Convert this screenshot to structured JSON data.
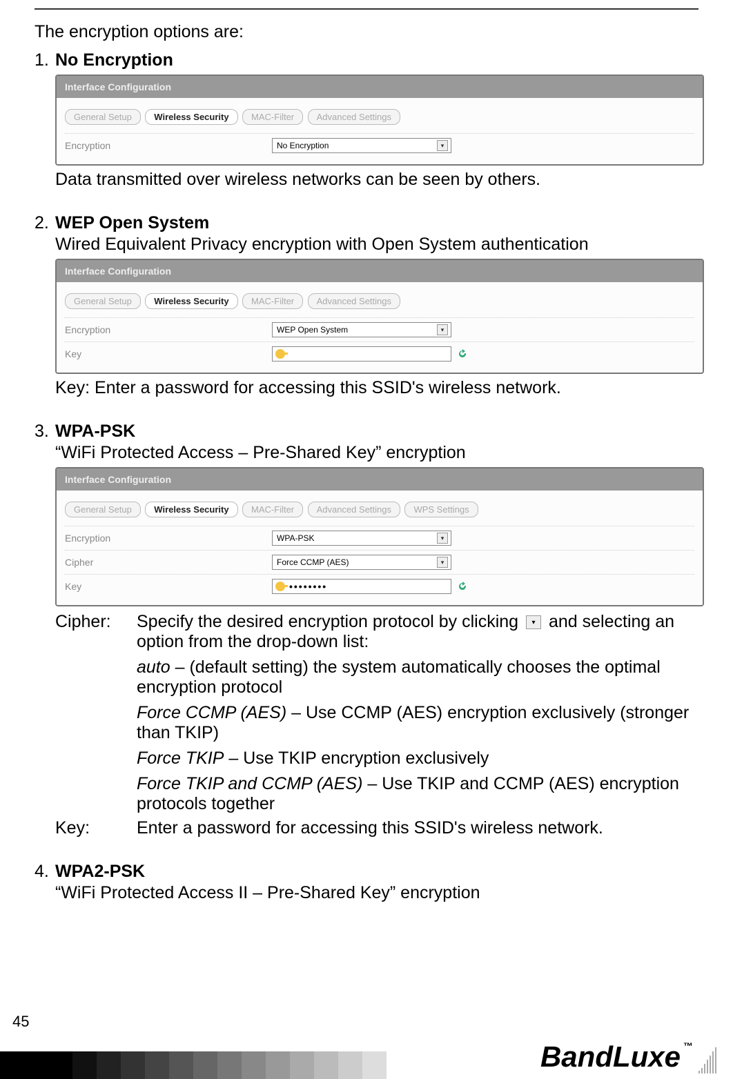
{
  "intro": "The encryption options are:",
  "items": [
    {
      "num": "1.",
      "title": "No Encryption",
      "panel": {
        "header": "Interface Configuration",
        "tabs": [
          "General Setup",
          "Wireless Security",
          "MAC-Filter",
          "Advanced Settings"
        ],
        "active_tab": 1,
        "rows": [
          {
            "label": "Encryption",
            "type": "select",
            "value": "No Encryption"
          }
        ]
      },
      "after": "Data transmitted over wireless networks can be seen by others."
    },
    {
      "num": "2.",
      "title": "WEP Open System",
      "subtitle": "Wired Equivalent Privacy encryption with Open System authentication",
      "panel": {
        "header": "Interface Configuration",
        "tabs": [
          "General Setup",
          "Wireless Security",
          "MAC-Filter",
          "Advanced Settings"
        ],
        "active_tab": 1,
        "rows": [
          {
            "label": "Encryption",
            "type": "select",
            "value": "WEP Open System"
          },
          {
            "label": "Key",
            "type": "key",
            "value": ""
          }
        ]
      },
      "after_key": "Key:    Enter a password for accessing this SSID's wireless network."
    },
    {
      "num": "3.",
      "title": "WPA-PSK",
      "subtitle": "“WiFi Protected Access – Pre-Shared Key” encryption",
      "panel": {
        "header": "Interface Configuration",
        "tabs": [
          "General Setup",
          "Wireless Security",
          "MAC-Filter",
          "Advanced Settings",
          "WPS Settings"
        ],
        "active_tab": 1,
        "rows": [
          {
            "label": "Encryption",
            "type": "select",
            "value": "WPA-PSK"
          },
          {
            "label": "Cipher",
            "type": "select",
            "value": "Force CCMP (AES)"
          },
          {
            "label": "Key",
            "type": "key",
            "value": "••••••••"
          }
        ]
      },
      "defs": {
        "cipher_label": "Cipher:",
        "cipher_intro_a": "Specify the desired encryption protocol by clicking",
        "cipher_intro_b": "and selecting an option from the drop-down list:",
        "options": [
          {
            "name": "auto",
            "sep": " – ",
            "text": "(default setting) the system automatically chooses the optimal encryption protocol"
          },
          {
            "name": "Force CCMP (AES)",
            "sep": " – ",
            "text": "Use CCMP (AES) encryption exclusively (stronger than TKIP)"
          },
          {
            "name": "Force TKIP",
            "sep": " – ",
            "text": "Use TKIP encryption exclusively"
          },
          {
            "name": "Force TKIP and CCMP (AES)",
            "sep": " – ",
            "text": "Use TKIP and CCMP (AES) encryption protocols together"
          }
        ],
        "key_label": "Key:",
        "key_text": "Enter a password for accessing this SSID's wireless network."
      }
    },
    {
      "num": "4.",
      "title": "WPA2-PSK",
      "subtitle": "“WiFi Protected Access II – Pre-Shared Key” encryption"
    }
  ],
  "page_number": "45",
  "brand": "BandLuxe",
  "tm": "™",
  "arrow_glyph": "▾",
  "grad_colors": [
    "#000",
    "#000",
    "#000",
    "#111",
    "#222",
    "#333",
    "#444",
    "#555",
    "#666",
    "#777",
    "#888",
    "#999",
    "#aaa",
    "#bbb",
    "#ccc",
    "#ddd"
  ]
}
